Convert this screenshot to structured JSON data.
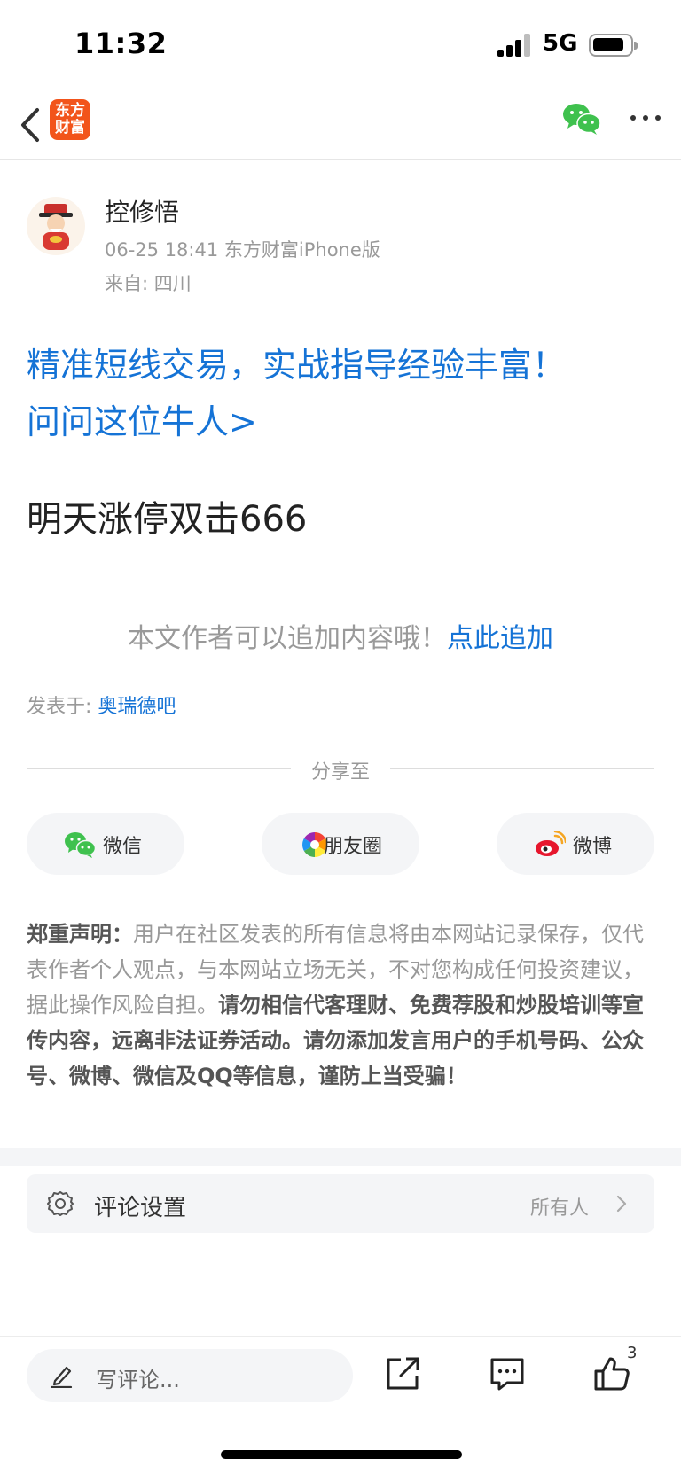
{
  "status_bar": {
    "time": "11:32",
    "network": "5G"
  },
  "nav": {
    "app_logo_text": [
      "东方",
      "财富"
    ]
  },
  "author": {
    "name": "控修悟",
    "meta": "06-25 18:41 东方财富iPhone版",
    "location": "来自: 四川"
  },
  "promo": {
    "line1": "精准短线交易，实战指导经验丰富！",
    "line2": "问问这位牛人>"
  },
  "post": {
    "content": "明天涨停双击666"
  },
  "append": {
    "hint": "本文作者可以追加内容哦！",
    "link": "点此追加"
  },
  "posted_in": {
    "prefix": "发表于:",
    "forum": "奥瑞德吧"
  },
  "share": {
    "title": "分享至",
    "buttons": [
      {
        "label": "微信",
        "icon": "wechat-icon"
      },
      {
        "label": "朋友圈",
        "icon": "moments-icon"
      },
      {
        "label": "微博",
        "icon": "weibo-icon"
      }
    ]
  },
  "disclaimer": {
    "title": "郑重声明：",
    "normal": "用户在社区发表的所有信息将由本网站记录保存，仅代表作者个人观点，与本网站立场无关，不对您构成任何投资建议，据此操作风险自担。",
    "bold": "请勿相信代客理财、免费荐股和炒股培训等宣传内容，远离非法证券活动。请勿添加发言用户的手机号码、公众号、微博、微信及QQ等信息，谨防上当受骗！"
  },
  "comment_settings": {
    "title": "评论设置",
    "value": "所有人"
  },
  "bottom_bar": {
    "placeholder": "写评论...",
    "like_count": "3"
  },
  "colors": {
    "link": "#1573d6",
    "brand": "#f2541b",
    "wechat": "#3fc14e",
    "weibo": "#e6162d"
  }
}
